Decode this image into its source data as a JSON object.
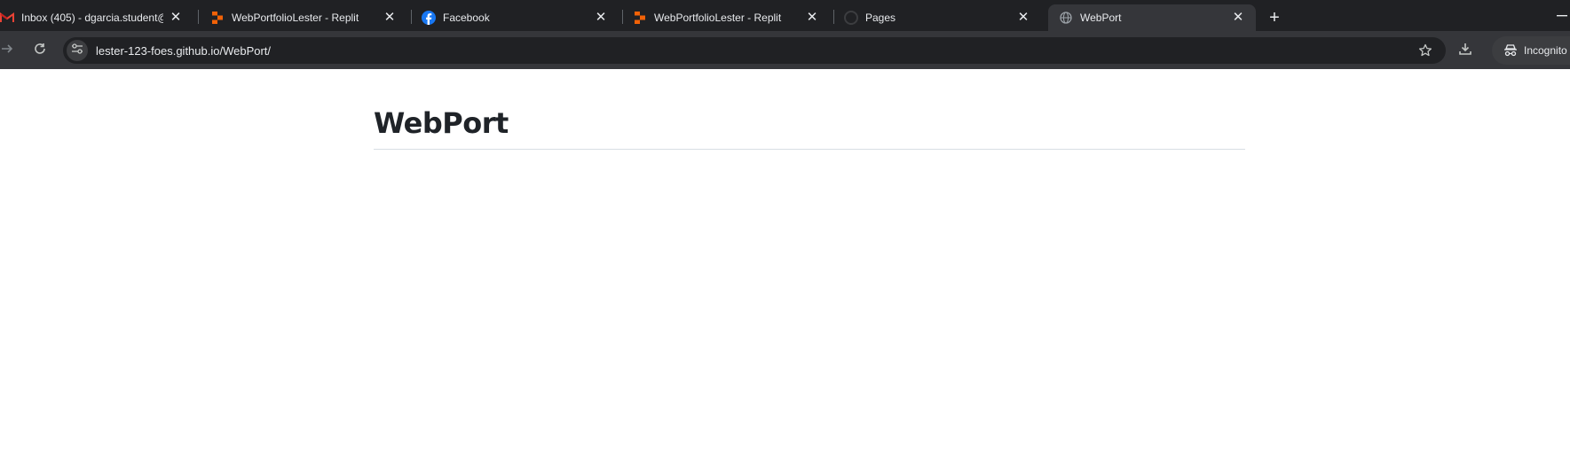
{
  "browser": {
    "tabs": [
      {
        "title": "Inbox (405) - dgarcia.student@",
        "favicon": "gmail-icon",
        "active": false
      },
      {
        "title": "WebPortfolioLester - Replit",
        "favicon": "replit-icon",
        "active": false
      },
      {
        "title": "Facebook",
        "favicon": "facebook-icon",
        "active": false
      },
      {
        "title": "WebPortfolioLester - Replit",
        "favicon": "replit-icon",
        "active": false
      },
      {
        "title": "Pages",
        "favicon": "github-icon",
        "active": false
      },
      {
        "title": "WebPort",
        "favicon": "globe-icon",
        "active": true
      }
    ],
    "close_glyph": "✕",
    "new_tab_glyph": "+",
    "address": "lester-123-foes.github.io/WebPort/",
    "incognito_label": "Incognito",
    "colors": {
      "tabstrip": "#202124",
      "toolbar": "#35363a",
      "omnibox": "#202124",
      "text": "#e8eaed"
    }
  },
  "page": {
    "title": "WebPort"
  }
}
